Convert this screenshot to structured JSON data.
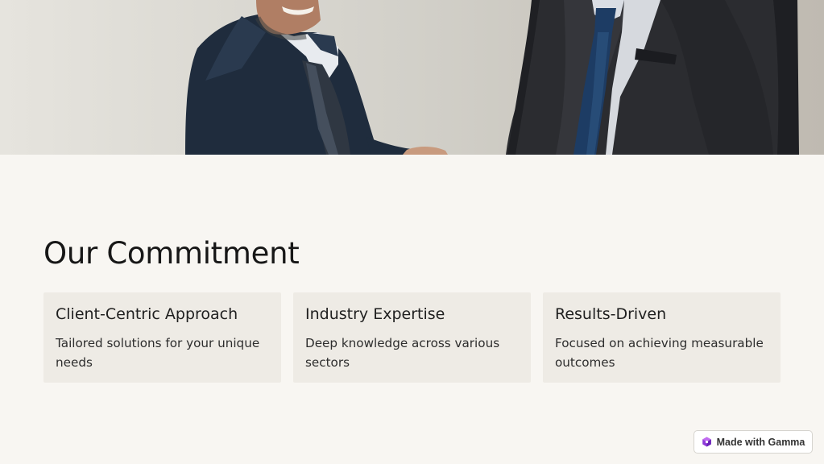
{
  "hero": {
    "image": "handshake-photo-businessmen"
  },
  "section": {
    "title": "Our Commitment"
  },
  "cards": [
    {
      "title": "Client-Centric Approach",
      "text": "Tailored solutions for your unique needs"
    },
    {
      "title": "Industry Expertise",
      "text": "Deep knowledge across various sectors"
    },
    {
      "title": "Results-Driven",
      "text": "Focused on achieving measurable outcomes"
    }
  ],
  "badge": {
    "label": "Made with Gamma",
    "icon": "gamma-logo-icon"
  },
  "colors": {
    "page_background": "#f8f6f2",
    "card_background": "#eeebe5",
    "badge_icon": "#8e3ad8"
  }
}
